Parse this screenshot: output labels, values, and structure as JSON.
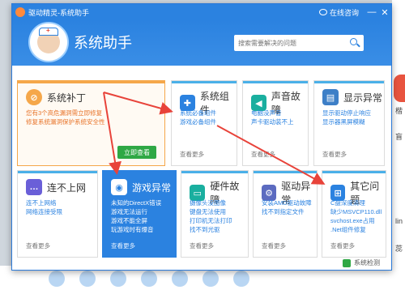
{
  "window": {
    "title": "驱动精灵-系统助手",
    "online_help": "在线咨询",
    "minimize": "—",
    "close": "✕"
  },
  "header": {
    "title": "系统助手",
    "search_placeholder": "搜索需要解决的问题"
  },
  "cards": [
    {
      "key": "patch",
      "title": "系统补丁",
      "lines": [
        "您有3个高危漏洞需立即修复",
        "修复系统漏洞保护系统安全性"
      ],
      "button": "立即查看"
    },
    {
      "key": "components",
      "title": "系统组件",
      "lines": [
        "系统必备组件",
        "游戏必备组件"
      ],
      "more": "查看更多"
    },
    {
      "key": "sound",
      "title": "声音故障",
      "lines": [
        "电脑没声音",
        "声卡驱动装不上"
      ],
      "more": "查看更多"
    },
    {
      "key": "display",
      "title": "显示异常",
      "lines": [
        "显示驱动停止响应",
        "显示器黑屏模糊"
      ],
      "more": "查看更多"
    },
    {
      "key": "network",
      "title": "连不上网",
      "lines": [
        "连不上网络",
        "网络连接受限"
      ],
      "more": "查看更多"
    },
    {
      "key": "game",
      "title": "游戏异常",
      "lines": [
        "未知的DirectX错误",
        "游戏无法运行",
        "游戏不能全屏",
        "玩游戏时有爆音"
      ],
      "more": "查看更多"
    },
    {
      "key": "hardware",
      "title": "硬件故障",
      "lines": [
        "摄像头没图像",
        "键盘无法使用",
        "打印机无法打印",
        "找不到光驱"
      ],
      "more": "查看更多"
    },
    {
      "key": "driver",
      "title": "驱动异常",
      "lines": [
        "安装AMD驱动故障",
        "找不到指定文件"
      ],
      "more": "查看更多"
    },
    {
      "key": "other",
      "title": "其它问题",
      "lines": [
        "C盘深度清理",
        "缺少MSVCP110.dll",
        "svchost.exe占用",
        ".Net组件修复"
      ],
      "more": "查看更多"
    }
  ],
  "footer": {
    "system_detect": "系统检测"
  },
  "background": {
    "side_text": [
      "楷",
      "盲 1",
      "lin",
      "蕊"
    ]
  },
  "colors": {
    "accent": "#2b82e0",
    "orange": "#f5a74a",
    "green": "#2fa845",
    "arrow": "#e8433a"
  }
}
